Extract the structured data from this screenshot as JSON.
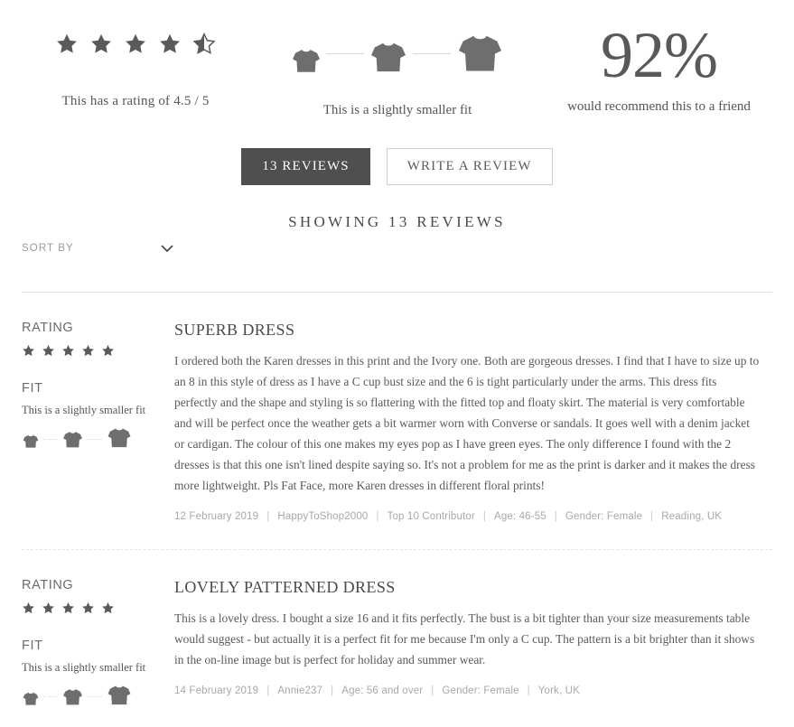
{
  "summary": {
    "rating": {
      "value": 4.5,
      "max": 5,
      "stars_filled": 4,
      "stars_half": 1,
      "caption": "This has a rating of 4.5 / 5"
    },
    "fit": {
      "caption": "This is a slightly smaller fit",
      "selected_index": 1,
      "options": [
        "smaller",
        "true to size",
        "larger"
      ]
    },
    "recommend": {
      "percent": "92%",
      "caption": "would recommend this to a friend"
    }
  },
  "tabs": {
    "reviews_button": "13 REVIEWS",
    "write_button": "WRITE A REVIEW"
  },
  "list_header": {
    "showing": "SHOWING 13 REVIEWS",
    "sort_label": "SORT BY",
    "sort_icon": "chevron-down-icon"
  },
  "labels": {
    "rating": "RATING",
    "fit": "FIT"
  },
  "colors": {
    "accent_dark": "#4f4f4f",
    "star": "#5a5a5a",
    "shirt": "#6e6e6e",
    "meta_text": "#a8a8a8",
    "rule": "#e2e2e2"
  },
  "reviews": [
    {
      "rating_label": "RATING",
      "stars": 5,
      "fit_label": "FIT",
      "fit_text": "This is a slightly smaller fit",
      "fit_selected_index": 2,
      "title": "SUPERB DRESS",
      "body": "I ordered both the Karen dresses in this print and the Ivory one. Both are gorgeous dresses. I find that I have to size up to an 8 in this style of dress as I have a C cup bust size and the 6 is tight particularly under the arms. This dress fits perfectly and the shape and styling is so flattering with the fitted top and floaty skirt. The material is very comfortable and will be perfect once the weather gets a bit warmer worn with Converse or sandals. It goes well with a denim jacket or cardigan. The colour of this one makes my eyes pop as I have green eyes. The only difference I found with the 2 dresses is that this one isn't lined despite saying so. It's not a problem for me as the print is darker and it makes the dress more lightweight. Pls Fat Face, more Karen dresses in different floral prints!",
      "meta": [
        "12 February 2019",
        "HappyToShop2000",
        "Top 10 Contributor",
        "Age: 46-55",
        "Gender: Female",
        "Reading, UK"
      ]
    },
    {
      "rating_label": "RATING",
      "stars": 5,
      "fit_label": "FIT",
      "fit_text": "This is a slightly smaller fit",
      "fit_selected_index": 2,
      "title": "LOVELY PATTERNED DRESS",
      "body": "This is a lovely dress. I bought a size 16 and it fits perfectly. The bust is a bit tighter than your size measurements table would suggest - but actually it is a perfect fit for me because I'm only a C cup. The pattern is a bit brighter than it shows in the on-line image but is perfect for holiday and summer wear.",
      "meta": [
        "14 February 2019",
        "Annie237",
        "Age: 56 and over",
        "Gender: Female",
        "York, UK"
      ]
    }
  ]
}
